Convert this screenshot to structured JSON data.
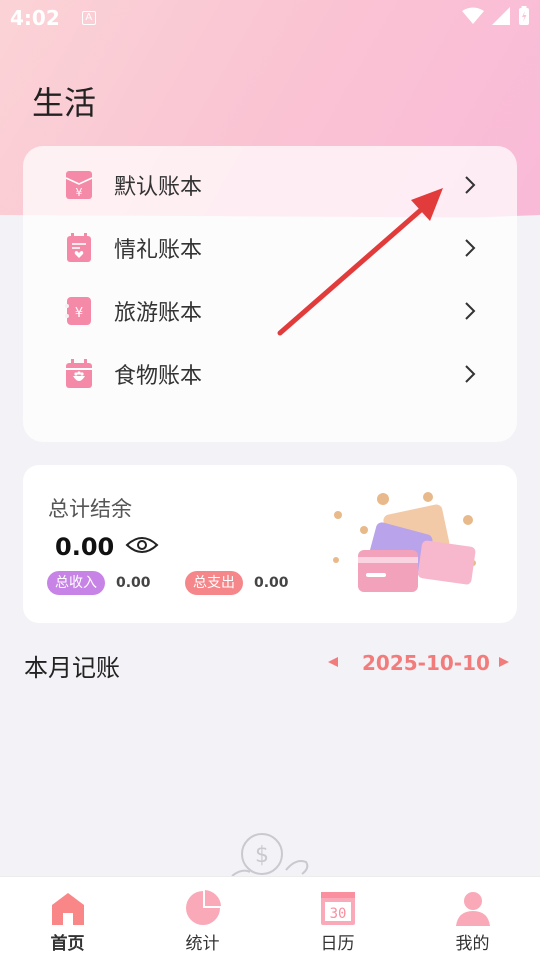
{
  "status": {
    "time": "4:02",
    "a_badge": "A"
  },
  "title": "生活",
  "books": [
    {
      "label": "默认账本",
      "icon": "book-yen-icon"
    },
    {
      "label": "情礼账本",
      "icon": "book-heart-icon"
    },
    {
      "label": "旅游账本",
      "icon": "book-yen-icon"
    },
    {
      "label": "食物账本",
      "icon": "calendar-food-icon"
    }
  ],
  "summary": {
    "title": "总计结余",
    "amount": "0.00",
    "income_label": "总收入",
    "income_value": "0.00",
    "expense_label": "总支出",
    "expense_value": "0.00"
  },
  "month": {
    "title": "本月记账",
    "date": "2025-10-10"
  },
  "tabs": [
    {
      "label": "首页",
      "icon": "home-icon"
    },
    {
      "label": "统计",
      "icon": "pie-chart-icon"
    },
    {
      "label": "日历",
      "icon": "calendar-icon",
      "day": "30"
    },
    {
      "label": "我的",
      "icon": "user-icon"
    }
  ],
  "colors": {
    "accent": "#f27c7c",
    "icon_pink": "#f56f86",
    "income_pill": "#c784e6",
    "expense_pill": "#f5868a",
    "annotation_arrow": "#e23b3b"
  }
}
